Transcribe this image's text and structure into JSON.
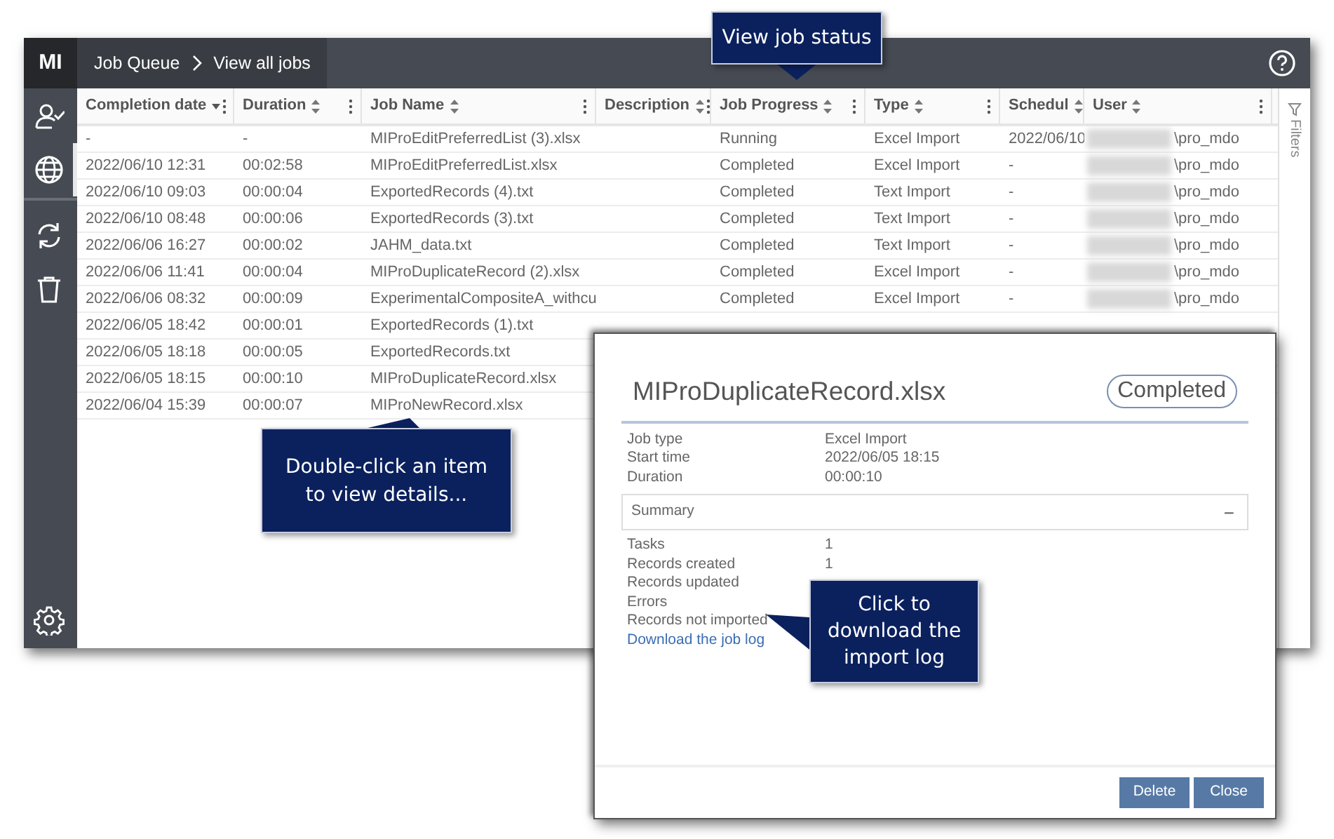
{
  "app_header": {
    "logo": "MI",
    "breadcrumb": [
      "Job Queue",
      "View all jobs"
    ]
  },
  "sidebar": {
    "groups": [
      {
        "items": [
          {
            "kind": "user",
            "selected": false
          },
          {
            "kind": "globe",
            "selected": true
          }
        ]
      },
      {
        "items": [
          {
            "kind": "refresh",
            "selected": false
          },
          {
            "kind": "trash",
            "selected": false
          }
        ]
      }
    ],
    "bottom_items": [
      {
        "kind": "settings",
        "selected": false
      }
    ]
  },
  "table": {
    "columns": [
      {
        "label": "Completion date",
        "sorted_descending": true,
        "menu": true
      },
      {
        "label": "Duration",
        "sorted_descending": false,
        "menu": true
      },
      {
        "label": "Job Name",
        "sorted_descending": false,
        "menu": true
      },
      {
        "label": "Description",
        "sorted_descending": false,
        "menu": true
      },
      {
        "label": "Job Progress",
        "sorted_descending": false,
        "menu": true
      },
      {
        "label": "Type",
        "sorted_descending": false,
        "menu": true
      },
      {
        "label": "Schedul",
        "sorted_descending": false,
        "menu": false
      },
      {
        "label": "User",
        "sorted_descending": false,
        "menu": true
      }
    ],
    "rows": [
      {
        "cells": [
          "-",
          "-",
          "MIProEditPreferredList (3).xlsx",
          null,
          "Running",
          "Excel Import",
          "2022/06/10",
          "\\pro_mdo"
        ]
      },
      {
        "cells": [
          "2022/06/10 12:31",
          "00:02:58",
          "MIProEditPreferredList.xlsx",
          null,
          "Completed",
          "Excel Import",
          "-",
          "\\pro_mdo"
        ]
      },
      {
        "cells": [
          "2022/06/10 09:03",
          "00:00:04",
          "ExportedRecords (4).txt",
          null,
          "Completed",
          "Text Import",
          "-",
          "\\pro_mdo"
        ]
      },
      {
        "cells": [
          "2022/06/10 08:48",
          "00:00:06",
          "ExportedRecords (3).txt",
          null,
          "Completed",
          "Text Import",
          "-",
          "\\pro_mdo"
        ]
      },
      {
        "cells": [
          "2022/06/06 16:27",
          "00:00:02",
          "JAHM_data.txt",
          null,
          "Completed",
          "Text Import",
          "-",
          "\\pro_mdo"
        ]
      },
      {
        "cells": [
          "2022/06/06 11:41",
          "00:00:04",
          "MIProDuplicateRecord (2).xlsx",
          null,
          "Completed",
          "Excel Import",
          "-",
          "\\pro_mdo"
        ]
      },
      {
        "cells": [
          "2022/06/06 08:32",
          "00:00:09",
          "ExperimentalCompositeA_withcu",
          null,
          "Completed",
          "Excel Import",
          "-",
          "\\pro_mdo"
        ]
      },
      {
        "cells": [
          "2022/06/05 18:42",
          "00:00:01",
          "ExportedRecords (1).txt"
        ]
      },
      {
        "cells": [
          "2022/06/05 18:18",
          "00:00:05",
          "ExportedRecords.txt"
        ]
      },
      {
        "cells": [
          "2022/06/05 18:15",
          "00:00:10",
          "MIProDuplicateRecord.xlsx"
        ]
      },
      {
        "cells": [
          "2022/06/04 15:39",
          "00:00:07",
          "MIProNewRecord.xlsx"
        ]
      }
    ]
  },
  "filters_panel": {
    "label": "Filters"
  },
  "dialog": {
    "title": "MIProDuplicateRecord.xlsx",
    "status": "Completed",
    "details": [
      {
        "label": "Job type",
        "value": "Excel Import"
      },
      {
        "label": "Start time",
        "value": "2022/06/05 18:15"
      },
      {
        "label": "Duration",
        "value": "00:00:10"
      }
    ],
    "summary": {
      "label": "Summary",
      "toggle": "−",
      "expanded": true,
      "rows": [
        {
          "label": "Tasks",
          "value": "1"
        },
        {
          "label": "Records created",
          "value": "1"
        },
        {
          "label": "Records updated"
        },
        {
          "label": "Errors"
        },
        {
          "label": "Records not imported"
        }
      ]
    },
    "link": "Download the job log",
    "buttons": [
      "Delete",
      "Close"
    ]
  },
  "callouts": [
    {
      "text": "View job status"
    },
    {
      "text": "Double-click an item to view details..."
    },
    {
      "text": "Click to download the import log"
    }
  ]
}
